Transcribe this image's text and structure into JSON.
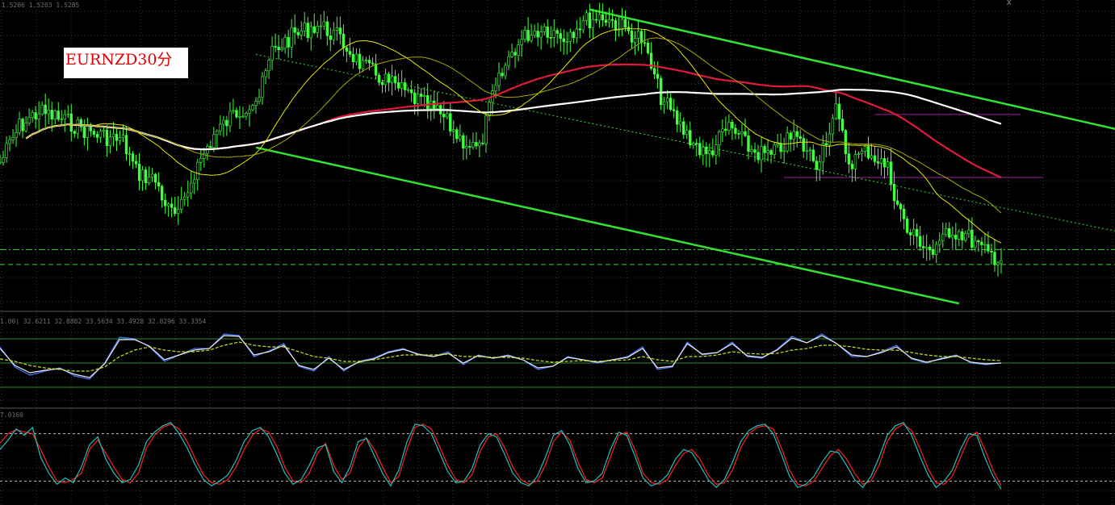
{
  "symbol_label": "EURNZD30分",
  "main_info": "1.5206 1.5203 1.5285",
  "ind1_info": "1.00) 32.6211 32.8882 33.5634 33.4928 32.8296 33.3354",
  "ind2_info": "7.0160",
  "close_glyph": "x",
  "colors": {
    "background": "#000000",
    "grid": "#3a3a3a",
    "candle": "#40ff40",
    "channel": "#33e033",
    "ma_red": "#e01a3c",
    "ma_white": "#ffffff",
    "ma_yellow": "#e6e600",
    "ma_yellow_dim": "#a8a800",
    "hline_purple": "#a020a0",
    "hline_green": "#3bd23b",
    "osc1_blue": "#4a78ff",
    "osc1_white": "#e8e8e8",
    "osc1_signal": "#c8e21a",
    "osc2_red": "#ff2020",
    "osc2_cyan": "#20c0c0"
  },
  "chart_data": [
    {
      "type": "candlestick",
      "title": "EURNZD30分",
      "bars": 310,
      "ylim": [
        0,
        100
      ],
      "close_path": [
        [
          0,
          52
        ],
        [
          6,
          40
        ],
        [
          12,
          35
        ],
        [
          20,
          38
        ],
        [
          28,
          42
        ],
        [
          38,
          45
        ],
        [
          42,
          55
        ],
        [
          48,
          58
        ],
        [
          52,
          68
        ],
        [
          55,
          70
        ],
        [
          60,
          55
        ],
        [
          66,
          43
        ],
        [
          72,
          36
        ],
        [
          80,
          30
        ],
        [
          84,
          15
        ],
        [
          90,
          10
        ],
        [
          98,
          6
        ],
        [
          104,
          10
        ],
        [
          112,
          20
        ],
        [
          118,
          24
        ],
        [
          124,
          28
        ],
        [
          130,
          32
        ],
        [
          136,
          36
        ],
        [
          142,
          44
        ],
        [
          148,
          48
        ],
        [
          152,
          30
        ],
        [
          158,
          15
        ],
        [
          163,
          9
        ],
        [
          168,
          7
        ],
        [
          174,
          10
        ],
        [
          180,
          5
        ],
        [
          186,
          3
        ],
        [
          192,
          7
        ],
        [
          198,
          11
        ],
        [
          204,
          30
        ],
        [
          210,
          40
        ],
        [
          218,
          50
        ],
        [
          225,
          40
        ],
        [
          232,
          48
        ],
        [
          238,
          50
        ],
        [
          245,
          43
        ],
        [
          252,
          52
        ],
        [
          258,
          35
        ],
        [
          262,
          52
        ],
        [
          268,
          48
        ],
        [
          274,
          54
        ],
        [
          276,
          62
        ],
        [
          280,
          75
        ],
        [
          284,
          78
        ],
        [
          288,
          82
        ],
        [
          292,
          74
        ],
        [
          298,
          76
        ],
        [
          304,
          82
        ],
        [
          309,
          84
        ]
      ],
      "moving_averages": [
        {
          "color": "red",
          "period": 100
        },
        {
          "color": "white",
          "period": 200
        },
        {
          "color": "yellow",
          "period": 30
        },
        {
          "color": "yellow",
          "period": 50
        }
      ],
      "channels": [
        {
          "style": "solid",
          "from": [
            182,
            1
          ],
          "to": [
            345,
            41
          ]
        },
        {
          "style": "solid",
          "from": [
            79,
            47
          ],
          "to": [
            296,
            99
          ]
        },
        {
          "style": "dotted",
          "from": [
            79,
            16
          ],
          "to": [
            345,
            75
          ]
        }
      ],
      "horizontal_lines": [
        {
          "level": 36,
          "color": "purple",
          "x_range": [
            270,
            315
          ]
        },
        {
          "level": 57,
          "color": "purple",
          "x_range": [
            242,
            322
          ]
        },
        {
          "level": 81,
          "color": "green",
          "style": "dash-dot"
        },
        {
          "level": 86,
          "color": "green",
          "style": "dashed"
        }
      ]
    },
    {
      "type": "line",
      "title": "",
      "ylim": [
        0,
        100
      ],
      "levels": [
        20,
        50,
        80
      ],
      "series": [
        {
          "color": "blue",
          "values": [
            70,
            45,
            35,
            40,
            44,
            34,
            30,
            50,
            82,
            80,
            70,
            52,
            60,
            68,
            68,
            86,
            84,
            58,
            65,
            74,
            46,
            40,
            58,
            40,
            52,
            56,
            64,
            68,
            60,
            58,
            64,
            48,
            60,
            56,
            60,
            54,
            42,
            46,
            58,
            54,
            50,
            54,
            58,
            70,
            42,
            45,
            76,
            60,
            63,
            76,
            58,
            56,
            67,
            83,
            75,
            86,
            74,
            58,
            58,
            64,
            72,
            55,
            50,
            56,
            60,
            50,
            48,
            50
          ]
        },
        {
          "color": "white",
          "values": [
            68,
            47,
            38,
            41,
            43,
            36,
            32,
            49,
            79,
            79,
            71,
            54,
            60,
            66,
            68,
            84,
            83,
            60,
            64,
            72,
            47,
            42,
            56,
            42,
            51,
            55,
            63,
            67,
            61,
            58,
            62,
            50,
            59,
            56,
            59,
            54,
            44,
            46,
            57,
            54,
            51,
            54,
            57,
            68,
            44,
            46,
            74,
            61,
            63,
            74,
            59,
            57,
            66,
            81,
            75,
            84,
            74,
            60,
            58,
            63,
            70,
            56,
            51,
            55,
            59,
            51,
            49,
            50
          ]
        },
        {
          "color": "signal-yellow",
          "values": [
            55,
            52,
            47,
            44,
            42,
            40,
            40,
            45,
            58,
            66,
            70,
            66,
            64,
            64,
            66,
            72,
            76,
            72,
            70,
            70,
            64,
            58,
            56,
            52,
            52,
            54,
            57,
            60,
            60,
            60,
            61,
            58,
            58,
            57,
            57,
            56,
            53,
            51,
            52,
            53,
            52,
            53,
            54,
            58,
            54,
            52,
            58,
            58,
            60,
            64,
            62,
            61,
            62,
            66,
            68,
            72,
            72,
            70,
            67,
            66,
            66,
            63,
            60,
            58,
            58,
            56,
            54,
            53
          ]
        }
      ]
    },
    {
      "type": "line",
      "title": "",
      "ylim": [
        0,
        100
      ],
      "levels": [
        20,
        80
      ],
      "series": [
        {
          "color": "red",
          "values": [
            68,
            80,
            85,
            82,
            80,
            60,
            38,
            20,
            18,
            22,
            30,
            60,
            72,
            55,
            38,
            22,
            18,
            30,
            62,
            78,
            88,
            92,
            86,
            70,
            48,
            28,
            18,
            16,
            22,
            38,
            60,
            78,
            86,
            82,
            64,
            38,
            20,
            18,
            30,
            55,
            68,
            40,
            22,
            30,
            62,
            75,
            60,
            38,
            18,
            26,
            60,
            88,
            92,
            86,
            64,
            40,
            22,
            18,
            28,
            58,
            76,
            80,
            62,
            38,
            22,
            16,
            20,
            40,
            70,
            82,
            72,
            44,
            22,
            18,
            24,
            50,
            78,
            82,
            60,
            30,
            18,
            16,
            22,
            40,
            55,
            60,
            48,
            28,
            16,
            18,
            34,
            62,
            80,
            88,
            90,
            86,
            62,
            34,
            16,
            14,
            20,
            36,
            52,
            60,
            48,
            30,
            16,
            20,
            40,
            70,
            86,
            92,
            84,
            62,
            36,
            18,
            16,
            26,
            50,
            74,
            82,
            60,
            34,
            14
          ]
        },
        {
          "color": "cyan",
          "values": [
            60,
            72,
            86,
            78,
            88,
            50,
            30,
            16,
            24,
            18,
            38,
            66,
            76,
            48,
            30,
            18,
            22,
            40,
            70,
            82,
            90,
            94,
            80,
            62,
            40,
            22,
            14,
            20,
            28,
            46,
            70,
            84,
            88,
            76,
            54,
            30,
            16,
            22,
            40,
            62,
            66,
            32,
            18,
            38,
            70,
            74,
            52,
            30,
            14,
            34,
            70,
            92,
            90,
            80,
            56,
            32,
            18,
            20,
            36,
            66,
            80,
            76,
            54,
            30,
            18,
            14,
            26,
            50,
            78,
            84,
            66,
            36,
            18,
            20,
            30,
            60,
            82,
            78,
            52,
            24,
            14,
            18,
            28,
            48,
            60,
            56,
            40,
            22,
            12,
            22,
            44,
            70,
            84,
            90,
            92,
            80,
            54,
            26,
            12,
            16,
            26,
            44,
            58,
            56,
            40,
            22,
            12,
            26,
            50,
            78,
            90,
            94,
            78,
            52,
            28,
            12,
            20,
            34,
            60,
            80,
            78,
            50,
            26,
            10
          ]
        }
      ]
    }
  ]
}
